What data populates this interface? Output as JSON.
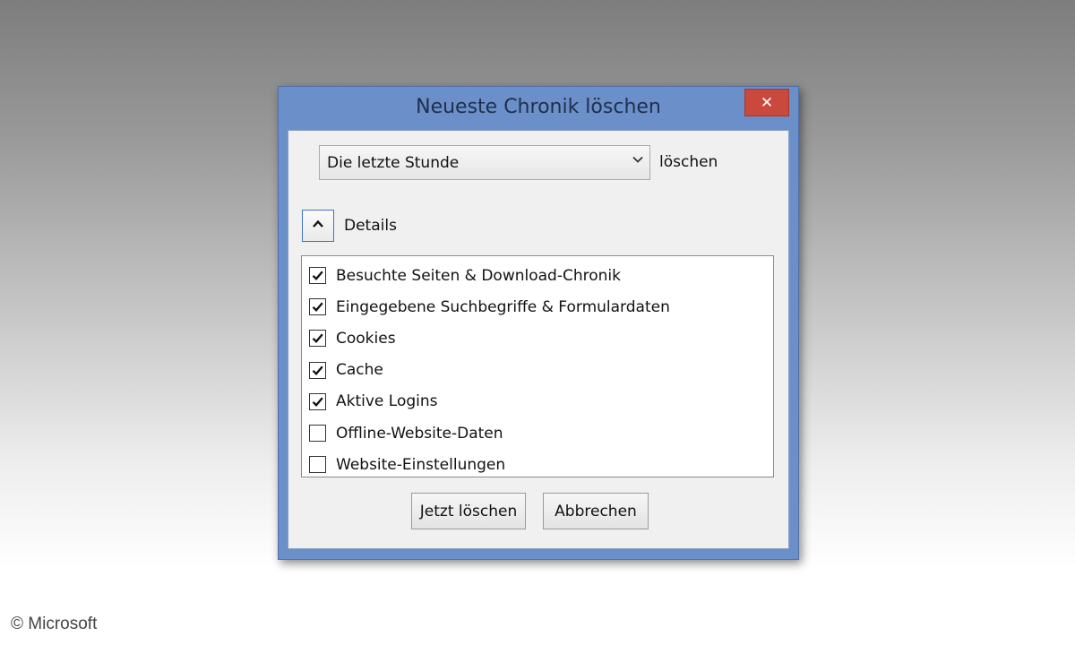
{
  "window": {
    "title": "Neueste Chronik löschen",
    "close_glyph": "✕"
  },
  "range": {
    "selected": "Die letzte Stunde",
    "suffix": "löschen"
  },
  "details": {
    "label": "Details",
    "expanded": true
  },
  "items": [
    {
      "label": "Besuchte Seiten & Download-Chronik",
      "checked": true
    },
    {
      "label": "Eingegebene Suchbegriffe & Formulardaten",
      "checked": true
    },
    {
      "label": "Cookies",
      "checked": true
    },
    {
      "label": "Cache",
      "checked": true
    },
    {
      "label": "Aktive Logins",
      "checked": true
    },
    {
      "label": "Offline-Website-Daten",
      "checked": false
    },
    {
      "label": "Website-Einstellungen",
      "checked": false
    }
  ],
  "buttons": {
    "clear_now": "Jetzt löschen",
    "cancel": "Abbrechen"
  },
  "copyright": "© Microsoft",
  "colors": {
    "titlebar": "#6b8fc8",
    "close": "#c9493c",
    "focus_border": "#3f74c2"
  },
  "icons": {
    "close": "close-icon",
    "dropdown": "chevron-down-icon",
    "collapse": "chevron-up-icon",
    "check": "checkmark-icon"
  }
}
